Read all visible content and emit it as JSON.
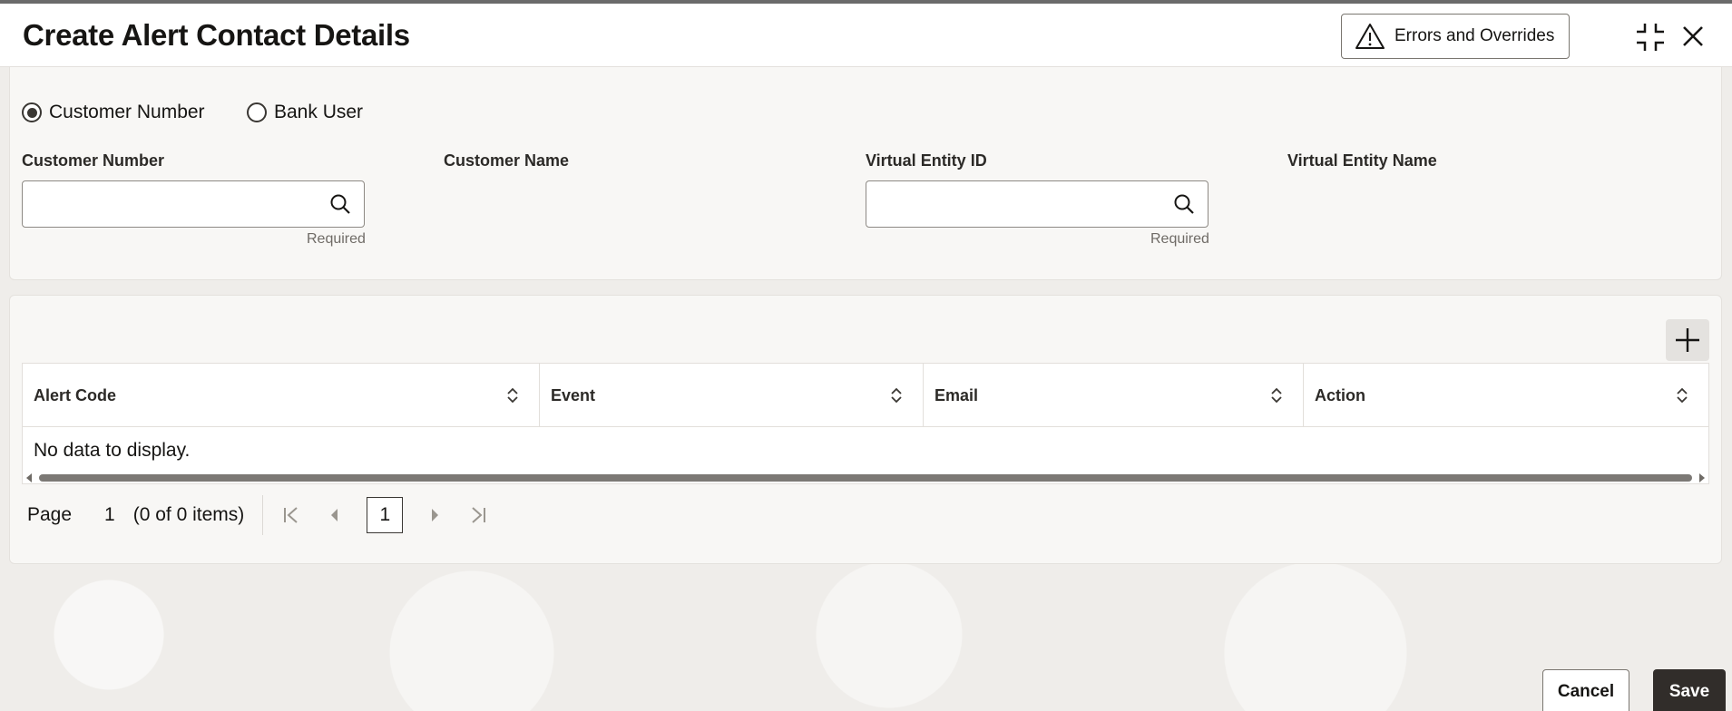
{
  "dialog": {
    "title": "Create Alert Contact Details",
    "errors_button_label": "Errors and Overrides"
  },
  "form": {
    "radio_options": [
      {
        "label": "Customer Number",
        "selected": true
      },
      {
        "label": "Bank User",
        "selected": false
      }
    ],
    "customer_number": {
      "label": "Customer Number",
      "value": "",
      "hint": "Required"
    },
    "customer_name": {
      "label": "Customer Name"
    },
    "virtual_entity_id": {
      "label": "Virtual Entity ID",
      "value": "",
      "hint": "Required"
    },
    "virtual_entity_name": {
      "label": "Virtual Entity Name"
    }
  },
  "table": {
    "columns": [
      "Alert Code",
      "Event",
      "Email",
      "Action"
    ],
    "empty_text": "No data to display."
  },
  "pagination": {
    "page_label": "Page",
    "current_page": "1",
    "items_text": "(0 of 0 items)",
    "page_button": "1"
  },
  "footer": {
    "cancel_label": "Cancel",
    "save_label": "Save"
  },
  "colors": {
    "primary_button": "#312d2a",
    "panel_background": "#f8f7f5"
  }
}
